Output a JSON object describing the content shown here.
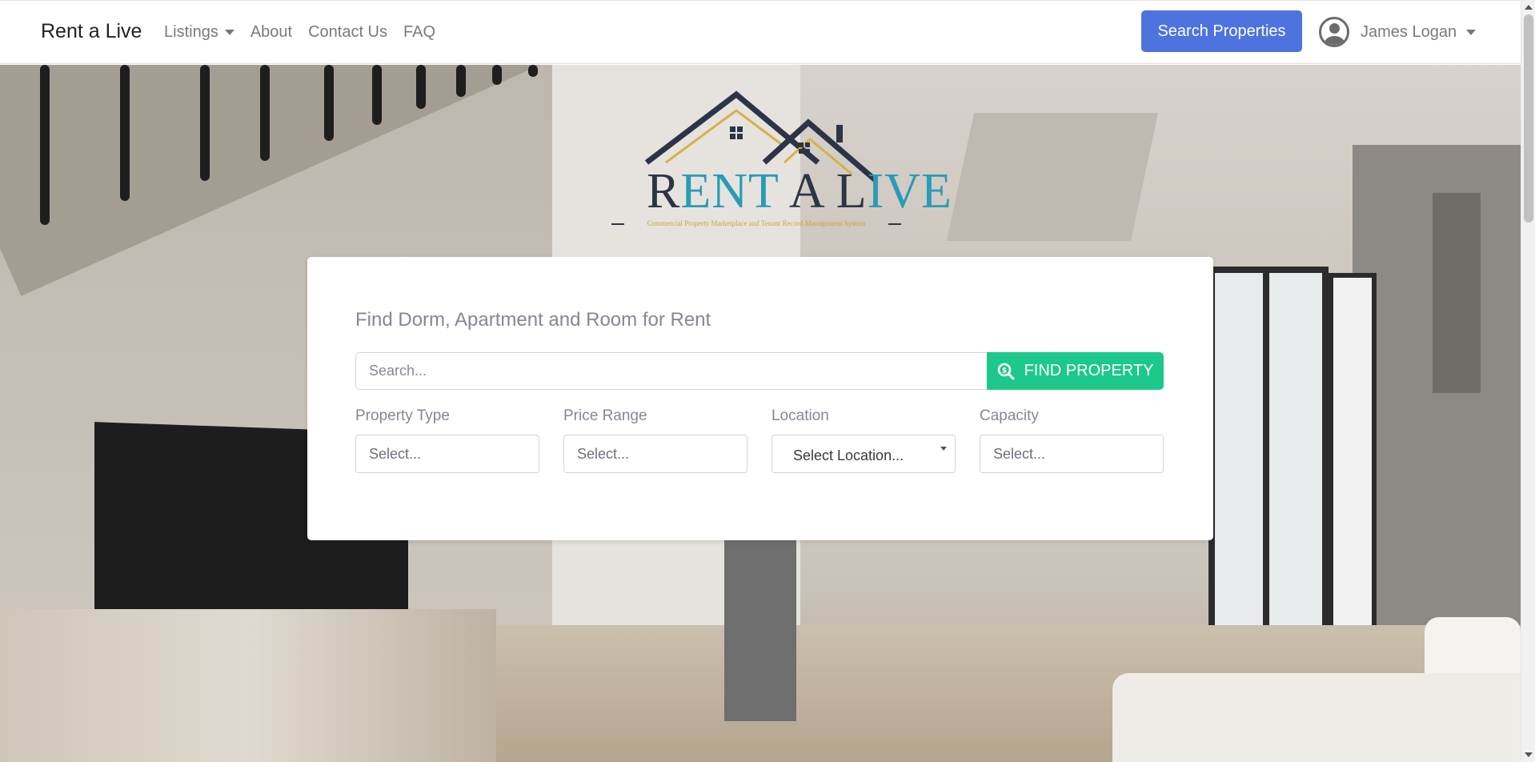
{
  "navbar": {
    "brand": "Rent a Live",
    "links": [
      {
        "label": "Listings",
        "dropdown": true
      },
      {
        "label": "About"
      },
      {
        "label": "Contact Us"
      },
      {
        "label": "FAQ"
      }
    ],
    "search_button": "Search Properties",
    "user": {
      "name": "James Logan",
      "icon": "user-circle-icon"
    }
  },
  "logo": {
    "wordmark": "Rent A Live",
    "tagline": "Commercial Property Marketplace and Tenant Record Management System",
    "colors": {
      "house": "#2c3447",
      "accent": "#d4b24a",
      "text_primary": "#2c3447",
      "text_secondary": "#2a9bb5"
    }
  },
  "search": {
    "title": "Find Dorm, Apartment and Room for Rent",
    "input_placeholder": "Search...",
    "find_button": "FIND PROPERTY",
    "find_icon": "search-dollar-icon",
    "filters": [
      {
        "label": "Property Type",
        "value": "Select..."
      },
      {
        "label": "Price Range",
        "value": "Select..."
      },
      {
        "label": "Location",
        "value": "Select Location..."
      },
      {
        "label": "Capacity",
        "value": "Select..."
      }
    ]
  },
  "colors": {
    "primary": "#4e73df",
    "success": "#1cc88a",
    "muted_text": "#858796"
  }
}
